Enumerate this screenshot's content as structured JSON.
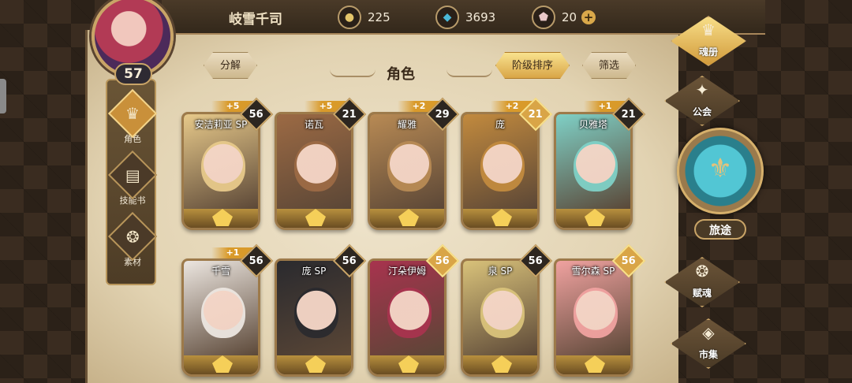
{
  "header": {
    "player_name": "岐雪千司",
    "level": "57",
    "gold": "225",
    "crystal": "3693",
    "gem": "20",
    "plus": "+"
  },
  "left_menu": [
    {
      "label": "角色",
      "icon": "helmet-icon",
      "active": true
    },
    {
      "label": "技能书",
      "icon": "book-icon",
      "active": false
    },
    {
      "label": "素材",
      "icon": "material-icon",
      "active": false
    }
  ],
  "toolbar": {
    "decompose": "分解",
    "title": "角色",
    "sort_by_rank": "阶级排序",
    "filter": "筛选"
  },
  "cards": [
    {
      "name": "安洁莉亚 SP",
      "level": "56",
      "plus": "+5",
      "gold_badge": false,
      "color": "#e7c98a"
    },
    {
      "name": "诺瓦",
      "level": "21",
      "plus": "+5",
      "gold_badge": false,
      "color": "#9c6a44"
    },
    {
      "name": "耀雅",
      "level": "29",
      "plus": "+2",
      "gold_badge": false,
      "color": "#b88a54"
    },
    {
      "name": "庞",
      "level": "21",
      "plus": "+2",
      "gold_badge": true,
      "color": "#c28a3e"
    },
    {
      "name": "贝雅塔",
      "level": "21",
      "plus": "+1",
      "gold_badge": false,
      "color": "#7fd0c6"
    },
    {
      "name": "千雪",
      "level": "56",
      "plus": "+1",
      "gold_badge": false,
      "color": "#ece6e0"
    },
    {
      "name": "庞 SP",
      "level": "56",
      "plus": "",
      "gold_badge": false,
      "color": "#2a2a2e"
    },
    {
      "name": "汀朵伊姆",
      "level": "56",
      "plus": "",
      "gold_badge": true,
      "color": "#a8334e"
    },
    {
      "name": "泉 SP",
      "level": "56",
      "plus": "",
      "gold_badge": false,
      "color": "#d9c27a"
    },
    {
      "name": "雪尔森 SP",
      "level": "56",
      "plus": "",
      "gold_badge": true,
      "color": "#f0a2a0"
    }
  ],
  "right_menu": {
    "soul_book": "魂册",
    "guild": "公会",
    "journey": "旅途",
    "soul_gift": "赋魂",
    "market": "市集"
  },
  "colors": {
    "accent_gold": "#d9a547",
    "parchment": "#e6d8b8",
    "frame": "#9d7a4a"
  }
}
